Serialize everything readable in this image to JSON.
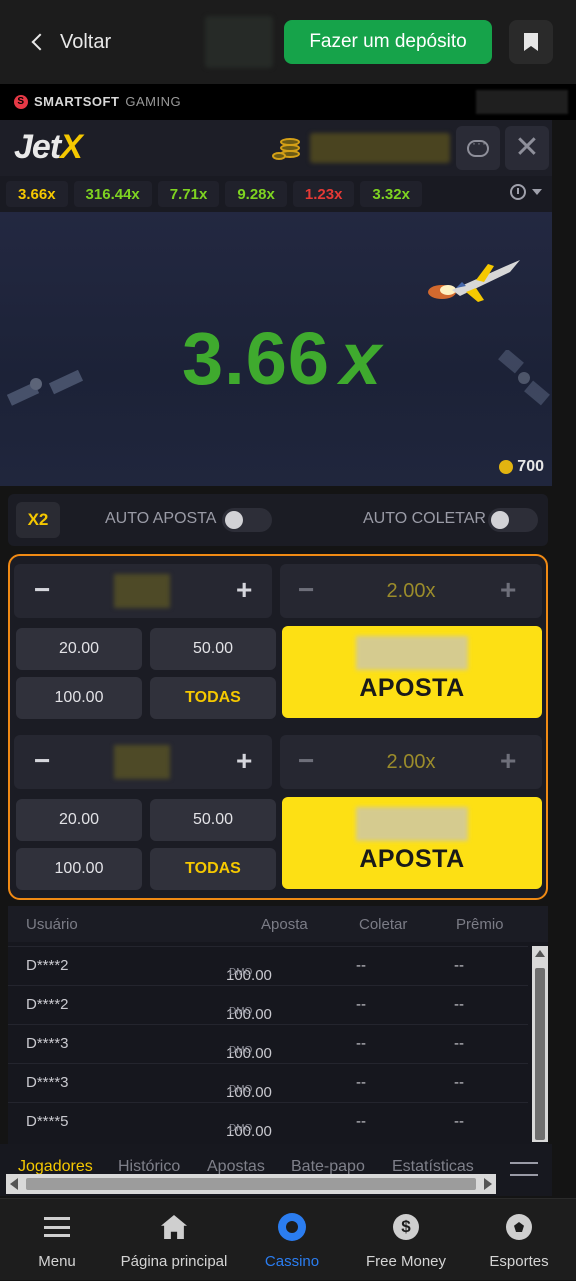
{
  "topbar": {
    "back_label": "Voltar",
    "deposit_label": "Fazer um depósito"
  },
  "provider": {
    "brand": "SMARTSOFT",
    "brand_suffix": "GAMING"
  },
  "game": {
    "logo_main": "Jet",
    "logo_accent": "X",
    "history": [
      {
        "value": "3.66x",
        "color": "#f5c800"
      },
      {
        "value": "316.44x",
        "color": "#7ed321"
      },
      {
        "value": "7.71x",
        "color": "#7ed321"
      },
      {
        "value": "9.28x",
        "color": "#7ed321"
      },
      {
        "value": "1.23x",
        "color": "#e53935"
      },
      {
        "value": "3.32x",
        "color": "#7ed321"
      }
    ],
    "multiplier": "3.66",
    "multiplier_suffix": "x",
    "players_count": "700"
  },
  "auto": {
    "x2_label": "X2",
    "auto_bet_label": "AUTO APOSTA",
    "auto_collect_label": "AUTO COLETAR"
  },
  "bets": [
    {
      "multiplier": "2.00x",
      "chips": [
        "20.00",
        "50.00",
        "100.00",
        "TODAS"
      ],
      "bet_label": "APOSTA"
    },
    {
      "multiplier": "2.00x",
      "chips": [
        "20.00",
        "50.00",
        "100.00",
        "TODAS"
      ],
      "bet_label": "APOSTA"
    }
  ],
  "players_table": {
    "headers": {
      "user": "Usuário",
      "bet": "Aposta",
      "collect": "Coletar",
      "prize": "Prêmio"
    },
    "rows": [
      {
        "user": "D****2",
        "bet": "100.00",
        "unit": "DMO",
        "collect": "--",
        "prize": "--"
      },
      {
        "user": "D****2",
        "bet": "100.00",
        "unit": "DMO",
        "collect": "--",
        "prize": "--"
      },
      {
        "user": "D****3",
        "bet": "100.00",
        "unit": "DMO",
        "collect": "--",
        "prize": "--"
      },
      {
        "user": "D****3",
        "bet": "100.00",
        "unit": "DMO",
        "collect": "--",
        "prize": "--"
      },
      {
        "user": "D****5",
        "bet": "100.00",
        "unit": "DMO",
        "collect": "--",
        "prize": "--"
      }
    ]
  },
  "tabs": [
    "Jogadores",
    "Histórico",
    "Apostas",
    "Bate-papo",
    "Estatísticas"
  ],
  "bottom_nav": [
    {
      "label": "Menu",
      "icon": "menu-icon"
    },
    {
      "label": "Página principal",
      "icon": "home-icon"
    },
    {
      "label": "Cassino",
      "icon": "casino-icon"
    },
    {
      "label": "Free Money",
      "icon": "dollar-icon"
    },
    {
      "label": "Esportes",
      "icon": "soccer-ball-icon"
    }
  ],
  "colors": {
    "accent_yellow": "#f5c800",
    "deposit_green": "#16a34a",
    "active_blue": "#2b7df0",
    "panel_border": "#f08a14",
    "multiplier_green": "#3faa2e"
  }
}
